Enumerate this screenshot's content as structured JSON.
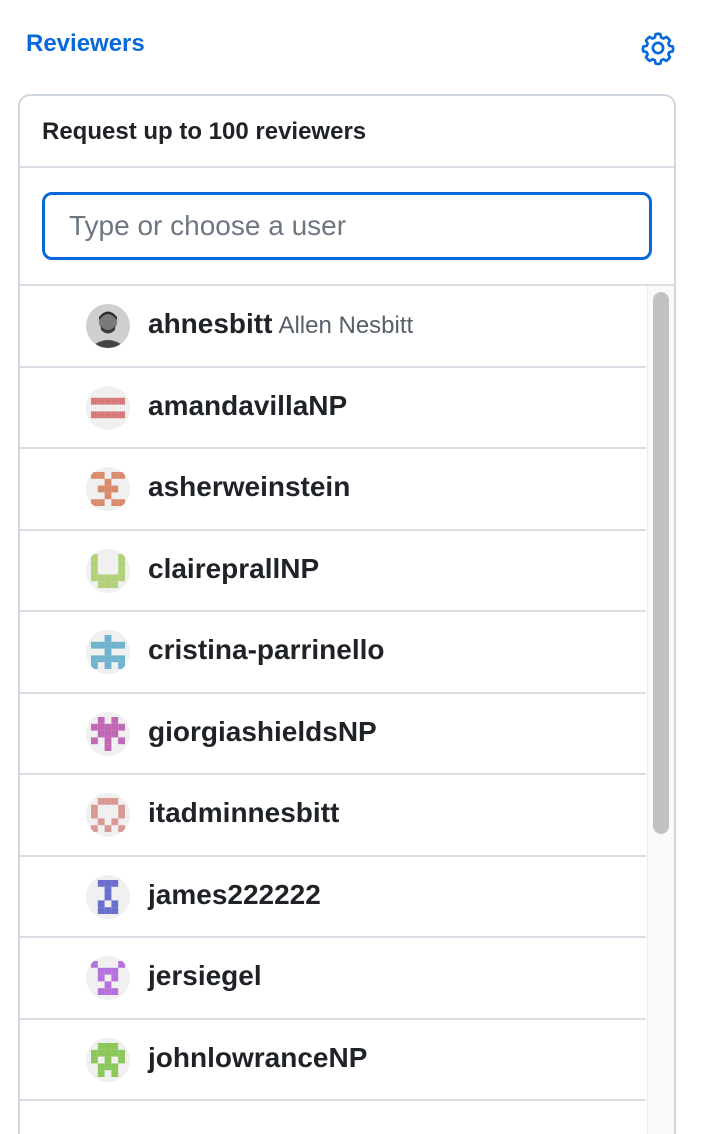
{
  "header": {
    "title": "Reviewers",
    "settings_icon": "gear-icon",
    "accent_color": "#0969da"
  },
  "panel": {
    "title": "Request up to 100 reviewers",
    "filter": {
      "placeholder": "Type or choose a user",
      "value": ""
    }
  },
  "users": [
    {
      "login": "ahnesbitt",
      "name": "Allen Nesbitt",
      "avatar": "photo-avatar"
    },
    {
      "login": "amandavillaNP",
      "name": "",
      "avatar": "identicon",
      "color": "#d57a78"
    },
    {
      "login": "asherweinstein",
      "name": "",
      "avatar": "identicon",
      "color": "#d98c6b"
    },
    {
      "login": "claireprallNP",
      "name": "",
      "avatar": "identicon",
      "color": "#b3d17a"
    },
    {
      "login": "cristina-parrinello",
      "name": "",
      "avatar": "identicon",
      "color": "#6fb3cf"
    },
    {
      "login": "giorgiashieldsNP",
      "name": "",
      "avatar": "identicon",
      "color": "#c068b4"
    },
    {
      "login": "itadminnesbitt",
      "name": "",
      "avatar": "identicon",
      "color": "#d99a94"
    },
    {
      "login": "james222222",
      "name": "",
      "avatar": "identicon",
      "color": "#6a6fd0"
    },
    {
      "login": "jersiegel",
      "name": "",
      "avatar": "identicon",
      "color": "#b572de"
    },
    {
      "login": "johnlowranceNP",
      "name": "",
      "avatar": "identicon",
      "color": "#8cc75a"
    }
  ]
}
